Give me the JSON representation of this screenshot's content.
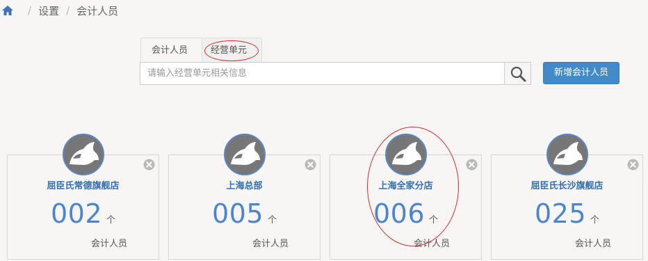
{
  "breadcrumb": {
    "items": [
      "设置",
      "会计人员"
    ],
    "separator": "/"
  },
  "tabs": [
    {
      "label": "会计人员"
    },
    {
      "label": "经营单元"
    }
  ],
  "search": {
    "value": "",
    "placeholder": "请输入经营单元相关信息"
  },
  "actions": {
    "add_label": "新增会计人员"
  },
  "cards": [
    {
      "name": "屈臣氏常德旗舰店",
      "count": "002",
      "unit": "个",
      "label": "会计人员"
    },
    {
      "name": "上海总部",
      "count": "005",
      "unit": "个",
      "label": "会计人员"
    },
    {
      "name": "上海全家分店",
      "count": "006",
      "unit": "个",
      "label": "会计人员"
    },
    {
      "name": "屈臣氏长沙旗舰店",
      "count": "025",
      "unit": "个",
      "label": "会计人员"
    }
  ],
  "icons": {
    "home": "home-icon",
    "search": "search-icon",
    "remove": "close-circle-icon",
    "avatar": "rhino-avatar-icon"
  },
  "colors": {
    "accent": "#428bca",
    "card_title": "#2f6fb6",
    "count": "#4a86cf",
    "annotation": "#d9292e"
  }
}
